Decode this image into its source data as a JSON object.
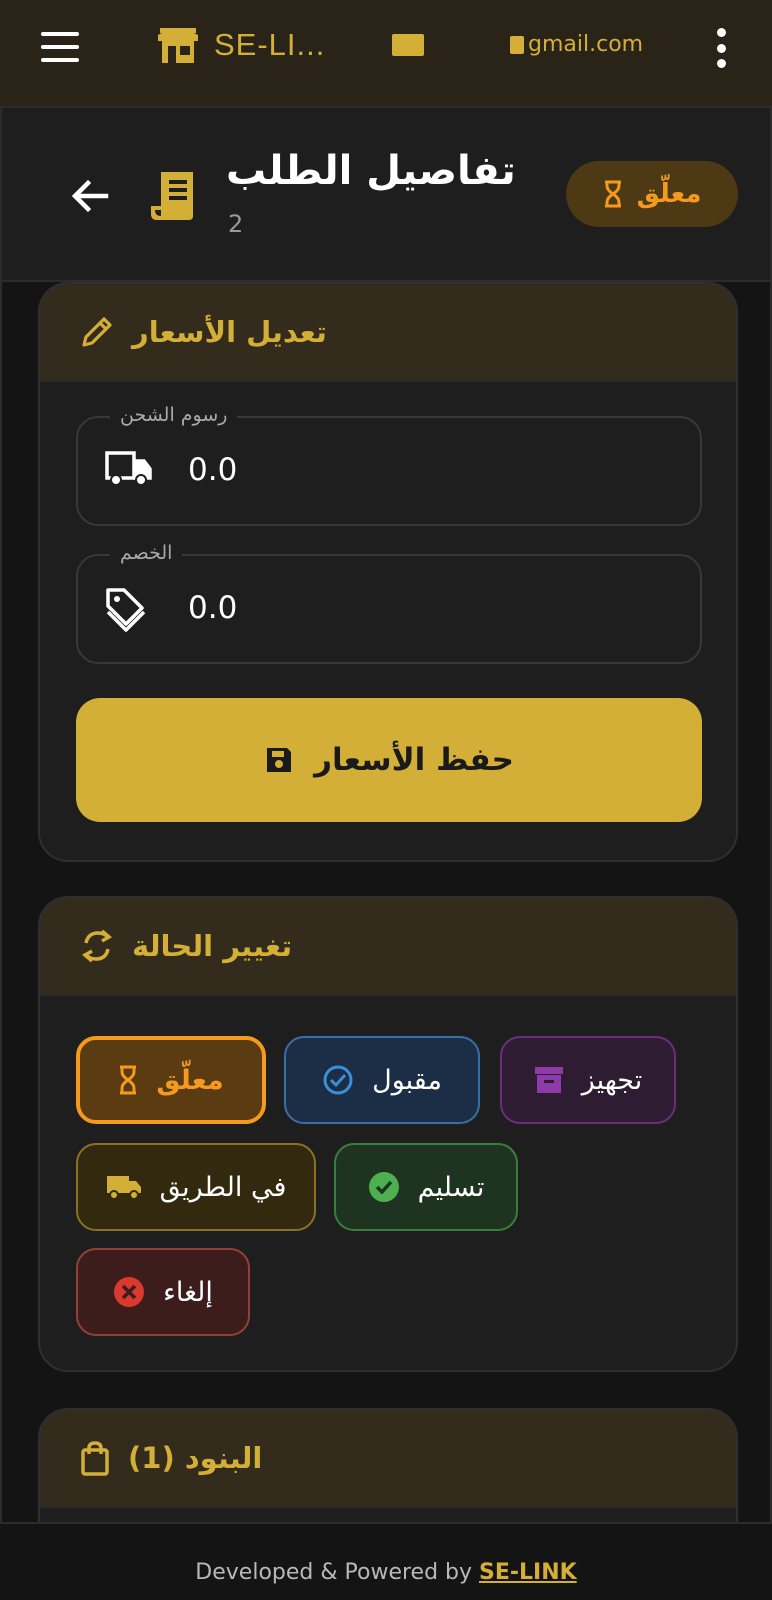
{
  "topbar": {
    "brand_name": "SE-LI...",
    "email_suffix": "gmail.com"
  },
  "header": {
    "title": "تفاصيل الطلب",
    "order_number": "2",
    "status_label": "معلّق"
  },
  "price_card": {
    "title": "تعديل الأسعار",
    "shipping_label": "رسوم الشحن",
    "shipping_value": "0.0",
    "discount_label": "الخصم",
    "discount_value": "0.0",
    "save_label": "حفظ الأسعار"
  },
  "status_card": {
    "title": "تغيير الحالة",
    "chips": [
      {
        "label": "معلّق",
        "icon": "hourglass-icon",
        "color": "#f59a1e",
        "selected": true
      },
      {
        "label": "مقبول",
        "icon": "check-circle-outline-icon",
        "color": "#3a8fd9"
      },
      {
        "label": "تجهيز",
        "icon": "archive-box-icon",
        "color": "#8e3aa8"
      },
      {
        "label": "في الطريق",
        "icon": "truck-icon",
        "color": "#d4af37"
      },
      {
        "label": "تسليم",
        "icon": "check-circle-icon",
        "color": "#4caf50"
      },
      {
        "label": "إلغاء",
        "icon": "cancel-circle-icon",
        "color": "#d9392f"
      }
    ]
  },
  "items_card": {
    "title": "البنود (1)"
  },
  "footer": {
    "prefix": "Developed & Powered by ",
    "link": "SE-LINK"
  },
  "colors": {
    "accent": "#d4af37",
    "pending": "#f59a1e",
    "topbar": "#2a2418"
  }
}
